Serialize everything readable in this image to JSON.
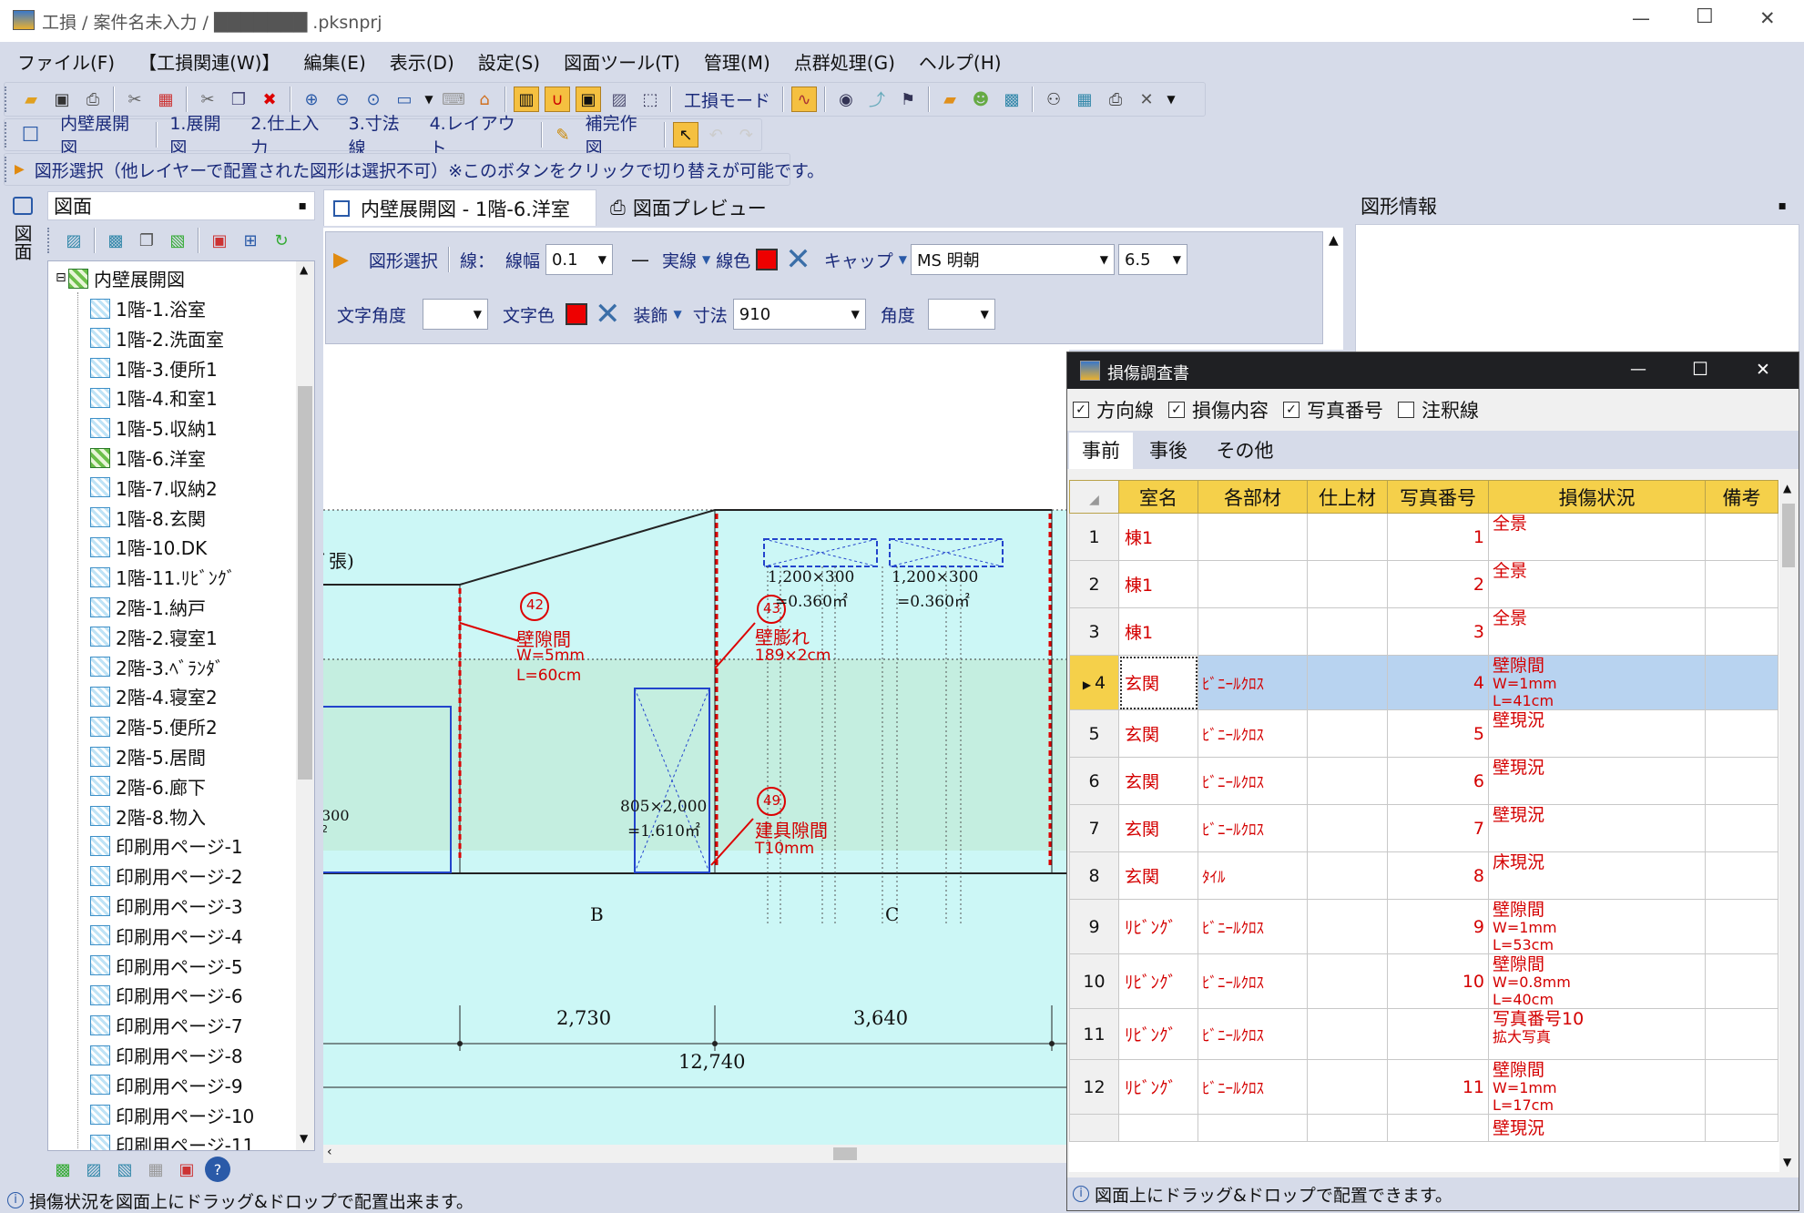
{
  "window": {
    "title": "工損 / 案件名未入力 / ███████ .pksnprj",
    "ctrl_min": "—",
    "ctrl_max": "☐",
    "ctrl_close": "✕"
  },
  "menu": [
    "ファイル(F)",
    "【工損関連(W)】",
    "編集(E)",
    "表示(D)",
    "設定(S)",
    "図面ツール(T)",
    "管理(M)",
    "点群処理(G)",
    "ヘルプ(H)"
  ],
  "toolbar1": {
    "mode_label": "工損モード"
  },
  "toolbar2": {
    "items": [
      "内壁展開図",
      "1.展開図",
      "2.仕上入力",
      "3.寸法線",
      "4.レイアウト",
      "補完作図"
    ]
  },
  "toolbar3": {
    "text": "図形選択（他レイヤーで配置された図形は選択不可）※このボタンをクリックで切り替えが可能です。"
  },
  "left_panel": {
    "side_tab": "図面",
    "header": "図面",
    "pin": "📌",
    "root": "内壁展開図",
    "items": [
      "1階-1.浴室",
      "1階-2.洗面室",
      "1階-3.便所1",
      "1階-4.和室1",
      "1階-5.収納1",
      "1階-6.洋室",
      "1階-7.収納2",
      "1階-8.玄関",
      "1階-10.DK",
      "1階-11.ﾘﾋﾞﾝｸﾞ",
      "2階-1.納戸",
      "2階-2.寝室1",
      "2階-3.ﾍﾞﾗﾝﾀﾞ",
      "2階-4.寝室2",
      "2階-5.便所2",
      "2階-5.居間",
      "2階-6.廊下",
      "2階-8.物入",
      "印刷用ページ-1",
      "印刷用ページ-2",
      "印刷用ページ-3",
      "印刷用ページ-4",
      "印刷用ページ-5",
      "印刷用ページ-6",
      "印刷用ページ-7",
      "印刷用ページ-8",
      "印刷用ページ-9",
      "印刷用ページ-10",
      "印刷用ページ-11"
    ],
    "selected_index": 5
  },
  "doc_tabs": [
    "内壁展開図 - 1階-6.洋室",
    "図面プレビュー"
  ],
  "props": {
    "select_label": "図形選択",
    "line_label": "線：",
    "width_label": "線幅",
    "width_value": "0.1",
    "line_type": "実線",
    "color_label": "線色",
    "cap_label": "キャップ",
    "font_value": "MS 明朝",
    "font_size": "6.5",
    "angle_label": "文字角度",
    "text_color_label": "文字色",
    "deco_label": "装飾",
    "dim_label": "寸法",
    "dim_value": "910",
    "angle2_label": "角度"
  },
  "drawing": {
    "frag_top": "ﾞ張)",
    "n42": "42",
    "t42a": "壁隙間",
    "t42b": "W=5mm",
    "t42c": "L=60cm",
    "n43": "43",
    "t43a": "壁膨れ",
    "t43b": "189×2cm",
    "n49": "49",
    "t49a": "建具隙間",
    "t49b": "T10mm",
    "win1a": "1,200×300",
    "win1b": "=0.360㎡",
    "win2a": "1,200×300",
    "win2b": "=0.360㎡",
    "door_a": "805×2,000",
    "door_b": "=1.610㎡",
    "left300": "300",
    "left2": "2",
    "lb": "B",
    "lc": "C",
    "d1": "2,730",
    "d2": "3,640",
    "total": "12,740"
  },
  "right_panel": {
    "header": "図形情報",
    "pin": "📌"
  },
  "dialog": {
    "title": "損傷調査書",
    "checks": [
      {
        "label": "方向線",
        "checked": true
      },
      {
        "label": "損傷内容",
        "checked": true
      },
      {
        "label": "写真番号",
        "checked": true
      },
      {
        "label": "注釈線",
        "checked": false
      }
    ],
    "tabs": [
      "事前",
      "事後",
      "その他"
    ],
    "columns": [
      "室名",
      "各部材",
      "仕上材",
      "写真番号",
      "損傷状況",
      "備考"
    ],
    "rows": [
      {
        "no": "1",
        "room": "棟1",
        "part": "",
        "finish": "",
        "photo": "1",
        "damage": [
          "全景"
        ]
      },
      {
        "no": "2",
        "room": "棟1",
        "part": "",
        "finish": "",
        "photo": "2",
        "damage": [
          "全景"
        ]
      },
      {
        "no": "3",
        "room": "棟1",
        "part": "",
        "finish": "",
        "photo": "3",
        "damage": [
          "全景"
        ]
      },
      {
        "no": "4",
        "room": "玄関",
        "part": "ﾋﾞﾆｰﾙｸﾛｽ",
        "finish": "",
        "photo": "4",
        "damage": [
          "壁隙間",
          "W=1mm",
          "L=41cm"
        ]
      },
      {
        "no": "5",
        "room": "玄関",
        "part": "ﾋﾞﾆｰﾙｸﾛｽ",
        "finish": "",
        "photo": "5",
        "damage": [
          "壁現況"
        ]
      },
      {
        "no": "6",
        "room": "玄関",
        "part": "ﾋﾞﾆｰﾙｸﾛｽ",
        "finish": "",
        "photo": "6",
        "damage": [
          "壁現況"
        ]
      },
      {
        "no": "7",
        "room": "玄関",
        "part": "ﾋﾞﾆｰﾙｸﾛｽ",
        "finish": "",
        "photo": "7",
        "damage": [
          "壁現況"
        ]
      },
      {
        "no": "8",
        "room": "玄関",
        "part": "ﾀｲﾙ",
        "finish": "",
        "photo": "8",
        "damage": [
          "床現況"
        ]
      },
      {
        "no": "9",
        "room": "ﾘﾋﾞﾝｸﾞ",
        "part": "ﾋﾞﾆｰﾙｸﾛｽ",
        "finish": "",
        "photo": "9",
        "damage": [
          "壁隙間",
          "W=1mm",
          "L=53cm"
        ]
      },
      {
        "no": "10",
        "room": "ﾘﾋﾞﾝｸﾞ",
        "part": "ﾋﾞﾆｰﾙｸﾛｽ",
        "finish": "",
        "photo": "10",
        "damage": [
          "壁隙間",
          "W=0.8mm",
          "L=40cm"
        ]
      },
      {
        "no": "11",
        "room": "ﾘﾋﾞﾝｸﾞ",
        "part": "ﾋﾞﾆｰﾙｸﾛｽ",
        "finish": "",
        "photo": "",
        "damage": [
          "写真番号10",
          "拡大写真"
        ]
      },
      {
        "no": "12",
        "room": "ﾘﾋﾞﾝｸﾞ",
        "part": "ﾋﾞﾆｰﾙｸﾛｽ",
        "finish": "",
        "photo": "11",
        "damage": [
          "壁隙間",
          "W=1mm",
          "L=17cm"
        ]
      }
    ],
    "selected_row": "4",
    "partial_row": "壁現況",
    "status": "図面上にドラッグ&ドロップで配置できます。"
  },
  "status_bar": "損傷状況を図面上にドラッグ&ドロップで配置出来ます。"
}
